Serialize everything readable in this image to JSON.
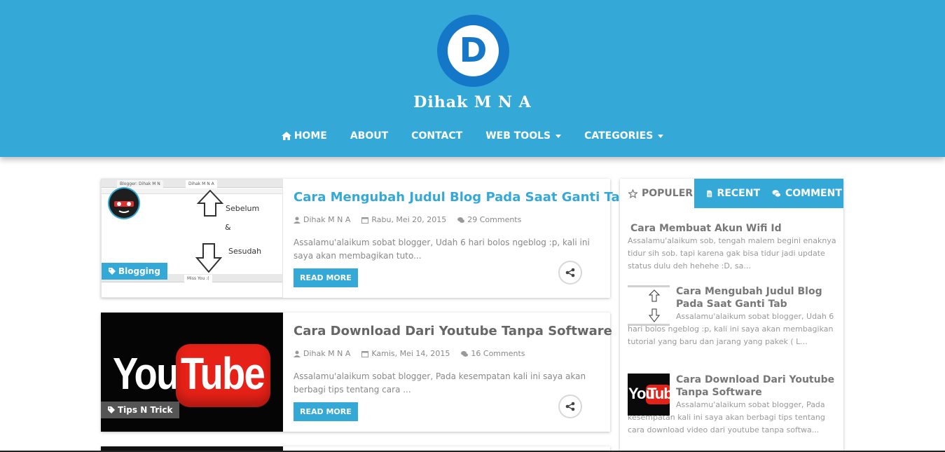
{
  "site": {
    "logo_letter": "D",
    "title": "Dihak M N A"
  },
  "nav": {
    "home": "HOME",
    "about": "ABOUT",
    "contact": "CONTACT",
    "web_tools": "WEB TOOLS",
    "categories": "CATEGORIES"
  },
  "posts": [
    {
      "title": "Cara Mengubah Judul Blog Pada Saat Ganti Tab",
      "author": "Dihak M N A",
      "date": "Rabu, Mei 20, 2015",
      "comments": "29 Comments",
      "excerpt": "Assalamu'alaikum sobat blogger, Udah 6 hari bolos ngeblog :p, kali ini saya akan membagikan tuto...",
      "category": "Blogging",
      "read_more": "READ MORE",
      "thumb_tab1": "Blogger: Dihak M N",
      "thumb_tab2": "Dihak M N A",
      "thumb_tab3": "Miss You :(",
      "thumb_sebelum": "Sebelum",
      "thumb_amp": "&",
      "thumb_sesudah": "Sesudah"
    },
    {
      "title": "Cara Download Dari Youtube Tanpa Software",
      "author": "Dihak M N A",
      "date": "Kamis, Mei 14, 2015",
      "comments": "16 Comments",
      "excerpt": "Assalamu'alaikum sobat blogger, Pada kesempatan kali ini saya akan berbagi tips tentang cara ...",
      "category": "Tips N Trick",
      "read_more": "READ MORE",
      "thumb_you": "You",
      "thumb_tube": "Tube"
    }
  ],
  "sidebar": {
    "tabs": {
      "popular": "POPULER",
      "recent": "RECENT",
      "comment": "COMMENT"
    },
    "items": [
      {
        "title": "Cara Membuat Akun Wifi Id",
        "desc": "Assalamu'alaikum sob, tengah malem begini enaknya tidur sih sob. tapi karena gak bisa tidur jadi update status dulu deh hehehe :D, sa..."
      },
      {
        "title": "Cara Mengubah Judul Blog Pada Saat Ganti Tab",
        "desc": "Assalamu'alaikum sobat blogger, Udah 6 hari bolos ngeblog :p, kali ini saya akan membagikan tutorial yang baru dan jarang yang pakek ( L..."
      },
      {
        "title": "Cara Download Dari Youtube Tanpa Software",
        "desc": "Assalamu'alaikum sobat blogger, Pada kesempatan kali ini saya akan berbagi tips tentang cara download video dari youtube tanpa softwa..."
      }
    ]
  },
  "colors": {
    "primary": "#34a9d8",
    "logo_ring": "#1477c8",
    "youtube_red": "#e62117"
  }
}
